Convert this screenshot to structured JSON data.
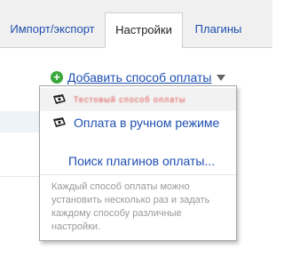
{
  "tabs": [
    {
      "label": "Импорт/экспорт",
      "active": false
    },
    {
      "label": "Настройки",
      "active": true
    },
    {
      "label": "Плагины",
      "active": false
    }
  ],
  "add_payment": {
    "label": "Добавить способ оплаты",
    "icon": "plus-circle-icon",
    "dropdown_icon": "caret-down-icon"
  },
  "menu": {
    "items": [
      {
        "label": "Тестовый способ оплаты",
        "icon": "money-bill-icon"
      },
      {
        "label": "Оплата в ручном режиме",
        "icon": "money-bill-icon"
      }
    ],
    "search_label": "Поиск плагинов оплаты...",
    "hint": "Каждый способ оплаты можно установить несколько раз и задать каждому способу различные настройки."
  },
  "colors": {
    "link": "#1e4fb0",
    "accent_green": "#3aa83a",
    "hint": "#999999"
  }
}
